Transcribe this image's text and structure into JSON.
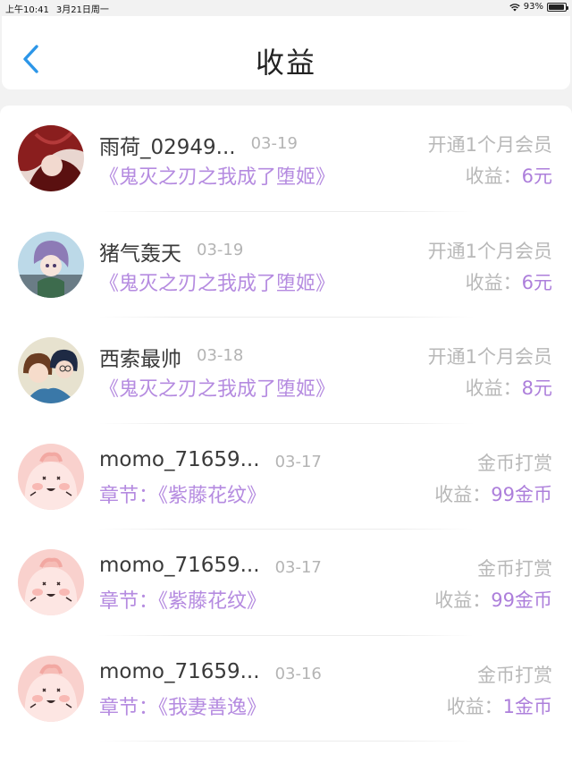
{
  "status_bar": {
    "time": "上午10:41",
    "date": "3月21日周一",
    "battery": "93%",
    "battery_level": 0.93
  },
  "header": {
    "title": "收益",
    "back_icon": "chevron-left-icon"
  },
  "colors": {
    "accent_blue": "#2c96e8",
    "purple": "#ad7fdb",
    "gray_text": "#b8b8b8"
  },
  "earnings_label": "收益：",
  "rows": [
    {
      "avatar": "anime-avatar-red",
      "username": "雨荷_02949...",
      "date": "03-19",
      "subtitle": "《鬼灭之刃之我成了堕姬》",
      "type": "开通1个月会员",
      "value": "6元"
    },
    {
      "avatar": "anime-avatar-purple-hair",
      "username": "猪气轰天",
      "date": "03-19",
      "subtitle": "《鬼灭之刃之我成了堕姬》",
      "type": "开通1个月会员",
      "value": "6元"
    },
    {
      "avatar": "anime-avatar-couple",
      "username": "西索最帅",
      "date": "03-18",
      "subtitle": "《鬼灭之刃之我成了堕姬》",
      "type": "开通1个月会员",
      "value": "8元"
    },
    {
      "avatar": "pink-blob-avatar",
      "username": "momo_71659...",
      "date": "03-17",
      "subtitle": "章节：《紫藤花纹》",
      "type": "金币打赏",
      "value": "99金币"
    },
    {
      "avatar": "pink-blob-avatar",
      "username": "momo_71659...",
      "date": "03-17",
      "subtitle": "章节：《紫藤花纹》",
      "type": "金币打赏",
      "value": "99金币"
    },
    {
      "avatar": "pink-blob-avatar",
      "username": "momo_71659...",
      "date": "03-16",
      "subtitle": "章节：《我妻善逸》",
      "type": "金币打赏",
      "value": "1金币"
    }
  ]
}
